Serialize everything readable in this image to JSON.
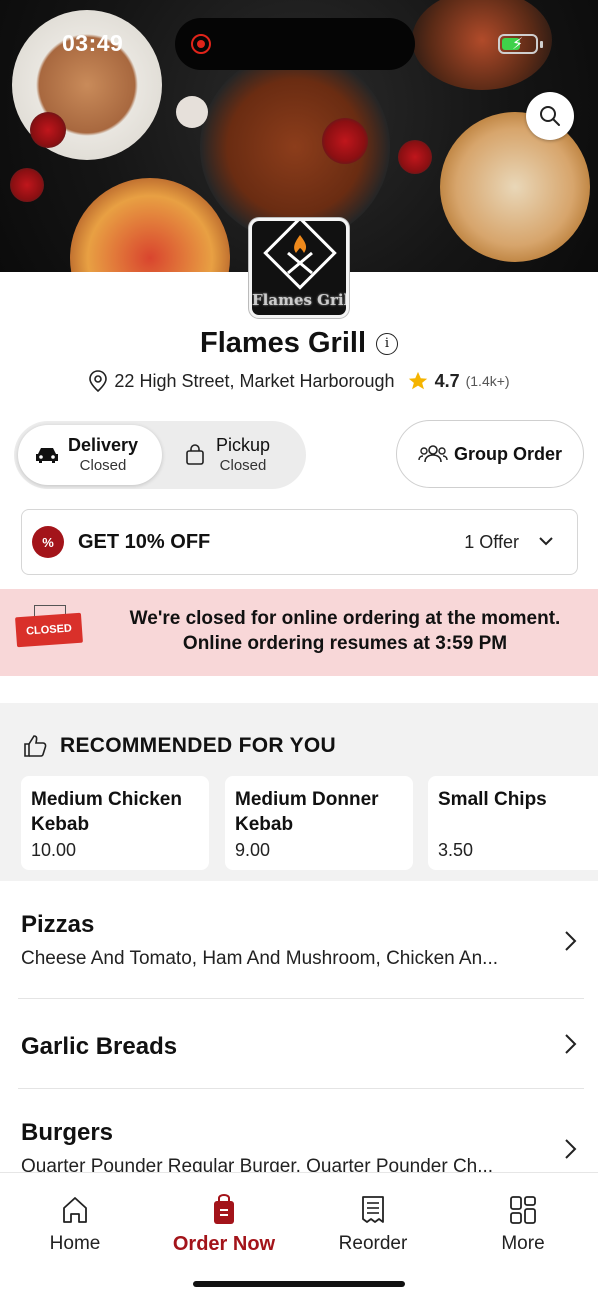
{
  "status_bar": {
    "time": "03:49"
  },
  "restaurant": {
    "name": "Flames Grill",
    "logo_text": "Flames Grill",
    "address": "22 High Street, Market Harborough",
    "rating": "4.7",
    "rating_count": "(1.4k+)"
  },
  "order_modes": {
    "delivery": {
      "label": "Delivery",
      "status": "Closed"
    },
    "pickup": {
      "label": "Pickup",
      "status": "Closed"
    }
  },
  "group_order_label": "Group Order",
  "offer": {
    "badge": "%",
    "title": "GET 10% OFF",
    "count": "1 Offer"
  },
  "closed_banner": {
    "sign": "CLOSED",
    "line1": "We're closed for online ordering at the moment.",
    "line2": "Online ordering resumes at 3:59 PM"
  },
  "recommended": {
    "title": "RECOMMENDED FOR YOU",
    "items": [
      {
        "name": "Medium Chicken Kebab",
        "price": "10.00"
      },
      {
        "name": "Medium Donner Kebab",
        "price": "9.00"
      },
      {
        "name": "Small Chips",
        "price": "3.50"
      }
    ]
  },
  "categories": [
    {
      "title": "Pizzas",
      "description": "Cheese And Tomato, Ham And Mushroom, Chicken An..."
    },
    {
      "title": "Garlic Breads",
      "description": ""
    },
    {
      "title": "Burgers",
      "description": "Quarter Pounder Regular Burger, Quarter Pounder Ch..."
    }
  ],
  "bottom_nav": [
    {
      "label": "Home",
      "icon": "home-icon"
    },
    {
      "label": "Order Now",
      "icon": "order-bag-icon"
    },
    {
      "label": "Reorder",
      "icon": "receipt-icon"
    },
    {
      "label": "More",
      "icon": "grid-icon"
    }
  ],
  "colors": {
    "brand": "#a3141a",
    "closed_banner_bg": "#f8d7d8",
    "star": "#f5b400",
    "battery": "#3fd14a"
  }
}
